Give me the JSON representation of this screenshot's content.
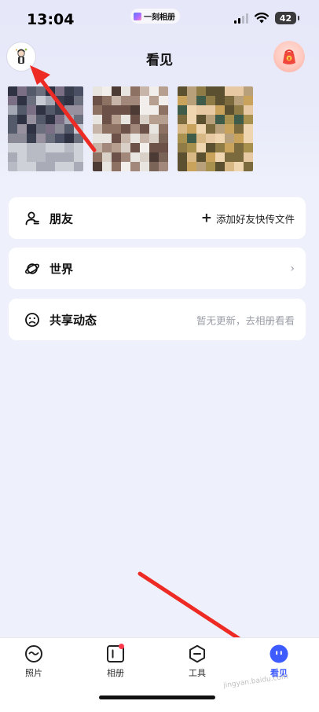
{
  "status_bar": {
    "time": "13:04",
    "app_name": "一刻相册",
    "battery": "42"
  },
  "header": {
    "title": "看见",
    "avatar_icon": "user-avatar-icon",
    "gift_icon": "red-envelope-gift-icon"
  },
  "photos": {
    "count": 3
  },
  "cards": [
    {
      "label": "朋友",
      "icon": "friends-icon",
      "right_text": "添加好友快传文件",
      "right_icon": "plus-icon"
    },
    {
      "label": "世界",
      "icon": "planet-icon",
      "right_text": "",
      "right_icon": "chevron-right-icon"
    },
    {
      "label": "共享动态",
      "icon": "sad-face-icon",
      "right_text": "暂无更新，去相册看看"
    }
  ],
  "nav": [
    {
      "label": "照片",
      "icon": "photos-smile-icon",
      "active": false
    },
    {
      "label": "相册",
      "icon": "album-icon",
      "active": false,
      "badge": true
    },
    {
      "label": "工具",
      "icon": "tools-hexagon-icon",
      "active": false
    },
    {
      "label": "看见",
      "icon": "discover-face-icon",
      "active": true
    }
  ],
  "colors": {
    "accent": "#3d5bff",
    "arrow": "#ee2a24",
    "badge": "#ff3b4d",
    "background": "#eef1fb"
  },
  "watermark": "jingyan.baidu.com"
}
